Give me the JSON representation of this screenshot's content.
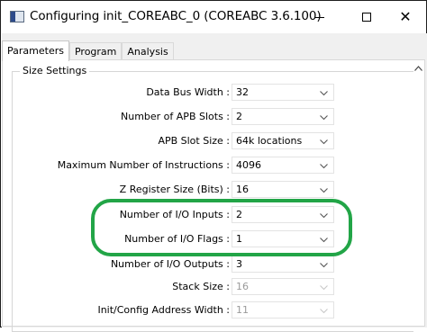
{
  "window": {
    "title": "Configuring init_COREABC_0 (COREABC 3.6.100)",
    "minimize_symbol": "—",
    "close_symbol": "✕"
  },
  "tabs": [
    {
      "label": "Parameters",
      "active": true
    },
    {
      "label": "Program",
      "active": false
    },
    {
      "label": "Analysis",
      "active": false
    }
  ],
  "group": {
    "title": "Size Settings"
  },
  "settings": [
    {
      "label": "Data Bus Width :",
      "value": "32",
      "enabled": true
    },
    {
      "label": "Number of APB Slots :",
      "value": "2",
      "enabled": true
    },
    {
      "label": "APB Slot Size :",
      "value": "64k locations",
      "enabled": true
    },
    {
      "label": "Maximum Number of Instructions :",
      "value": "4096",
      "enabled": true
    },
    {
      "label": "Z Register Size (Bits) :",
      "value": "16",
      "enabled": true
    },
    {
      "label": "Number of I/O Inputs :",
      "value": "2",
      "enabled": true
    },
    {
      "label": "Number of I/O Flags :",
      "value": "1",
      "enabled": true
    },
    {
      "label": "Number of I/O Outputs :",
      "value": "3",
      "enabled": true
    },
    {
      "label": "Stack Size :",
      "value": "16",
      "enabled": false
    },
    {
      "label": "Init/Config Address Width :",
      "value": "11",
      "enabled": false
    }
  ],
  "highlight_color": "#22a547",
  "icons": {
    "scroll_up": "chevron-up-icon",
    "dropdown": "chevron-down-icon"
  }
}
